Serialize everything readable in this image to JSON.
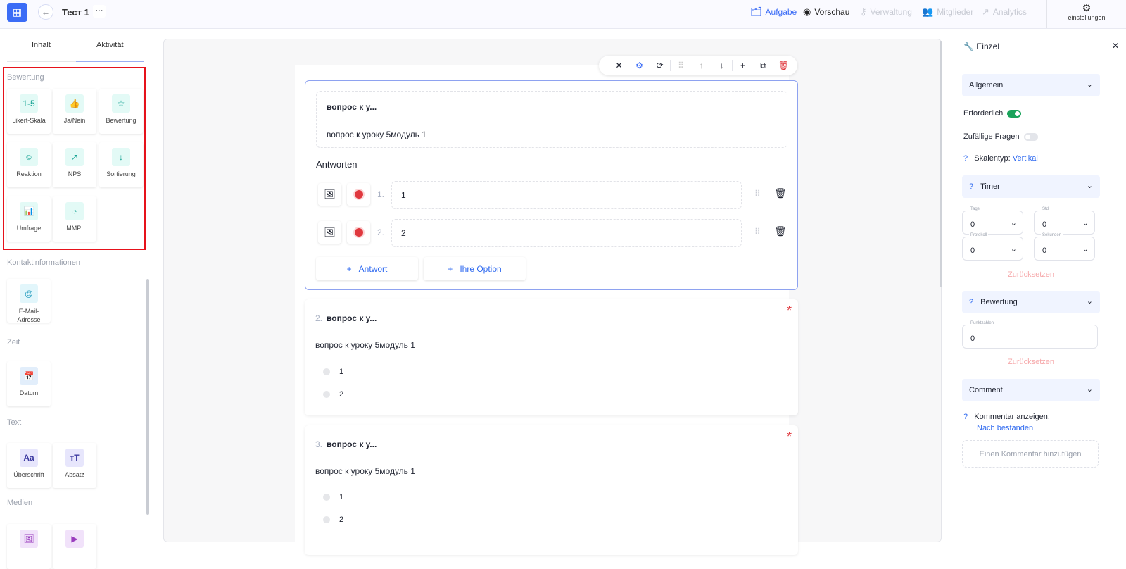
{
  "topbar": {
    "title": "Тест 1",
    "more": "···",
    "nav": [
      {
        "label": "Aufgabe",
        "icon": "briefcase-icon",
        "active": true
      },
      {
        "label": "Vorschau",
        "icon": "eye-icon",
        "active": false
      },
      {
        "label": "Verwaltung",
        "icon": "key-icon",
        "disabled": true
      },
      {
        "label": "Mitglieder",
        "icon": "users-icon",
        "disabled": true
      },
      {
        "label": "Analytics",
        "icon": "trend-icon",
        "disabled": true
      }
    ],
    "settings": "einstellungen"
  },
  "sidebar": {
    "tabs": [
      "Inhalt",
      "Aktivität"
    ],
    "sections": [
      {
        "title": "Bewertung",
        "items": [
          {
            "label": "Likert-Skala",
            "icon": "1-5"
          },
          {
            "label": "Ja/Nein",
            "icon": "thumbs-icon"
          },
          {
            "label": "Bewertung",
            "icon": "star-icon"
          },
          {
            "label": "Reaktion",
            "icon": "smile-icon"
          },
          {
            "label": "NPS",
            "icon": "trend-icon"
          },
          {
            "label": "Sortierung",
            "icon": "sort-icon"
          },
          {
            "label": "Umfrage",
            "icon": "bar-chart-icon"
          },
          {
            "label": "MMPI",
            "icon": "pie-icon"
          }
        ]
      },
      {
        "title": "Kontaktinformationen",
        "items": [
          {
            "label": "E-Mail-Adresse",
            "icon": "at-icon"
          }
        ]
      },
      {
        "title": "Zeit",
        "items": [
          {
            "label": "Datum",
            "icon": "calendar-icon"
          }
        ]
      },
      {
        "title": "Text",
        "items": [
          {
            "label": "Überschrift",
            "icon": "Aa"
          },
          {
            "label": "Absatz",
            "icon": "тT"
          }
        ]
      },
      {
        "title": "Medien",
        "items": [
          {
            "label": "",
            "icon": "image-icon"
          },
          {
            "label": "",
            "icon": "video-icon"
          }
        ]
      }
    ]
  },
  "editor": {
    "q1": {
      "title": "вопрос к у...",
      "desc": "вопрос к уроку 5модуль 1",
      "answers_label": "Antworten",
      "answers": [
        {
          "n": "1.",
          "value": "1"
        },
        {
          "n": "2.",
          "value": "2"
        }
      ],
      "add_answer": "Antwort",
      "add_option": "Ihre Option"
    },
    "questions": [
      {
        "n": "2.",
        "title": "вопрос к у...",
        "desc": "вопрос к уроку 5модуль 1",
        "options": [
          "1",
          "2"
        ],
        "required": "*"
      },
      {
        "n": "3.",
        "title": "вопрос к у...",
        "desc": "вопрос к уроку 5модуль 1",
        "options": [
          "1",
          "2"
        ],
        "required": "*"
      }
    ]
  },
  "panel": {
    "title": "Einzel",
    "general": "Allgemein",
    "required": "Erforderlich",
    "required_on": true,
    "random": "Zufällige Fragen",
    "random_on": false,
    "q": "?",
    "scale_label": "Skalentyp:",
    "scale_value": "Vertikal",
    "timer": "Timer",
    "fields": [
      {
        "label": "Tage",
        "value": "0"
      },
      {
        "label": "Std",
        "value": "0"
      },
      {
        "label": "Protokoll",
        "value": "0"
      },
      {
        "label": "Sekunden",
        "value": "0"
      }
    ],
    "reset": "Zurücksetzen",
    "rating": "Bewertung",
    "points_label": "Punktzahlen",
    "points": "0",
    "comment": "Comment",
    "show_comment": "Kommentar anzeigen:",
    "show_comment_value": "Nach bestanden",
    "comment_placeholder": "Einen Kommentar hinzufügen"
  },
  "colors": {
    "accent": "#3b6cf6",
    "danger": "#e0383e",
    "highlight": "#e6121b"
  }
}
